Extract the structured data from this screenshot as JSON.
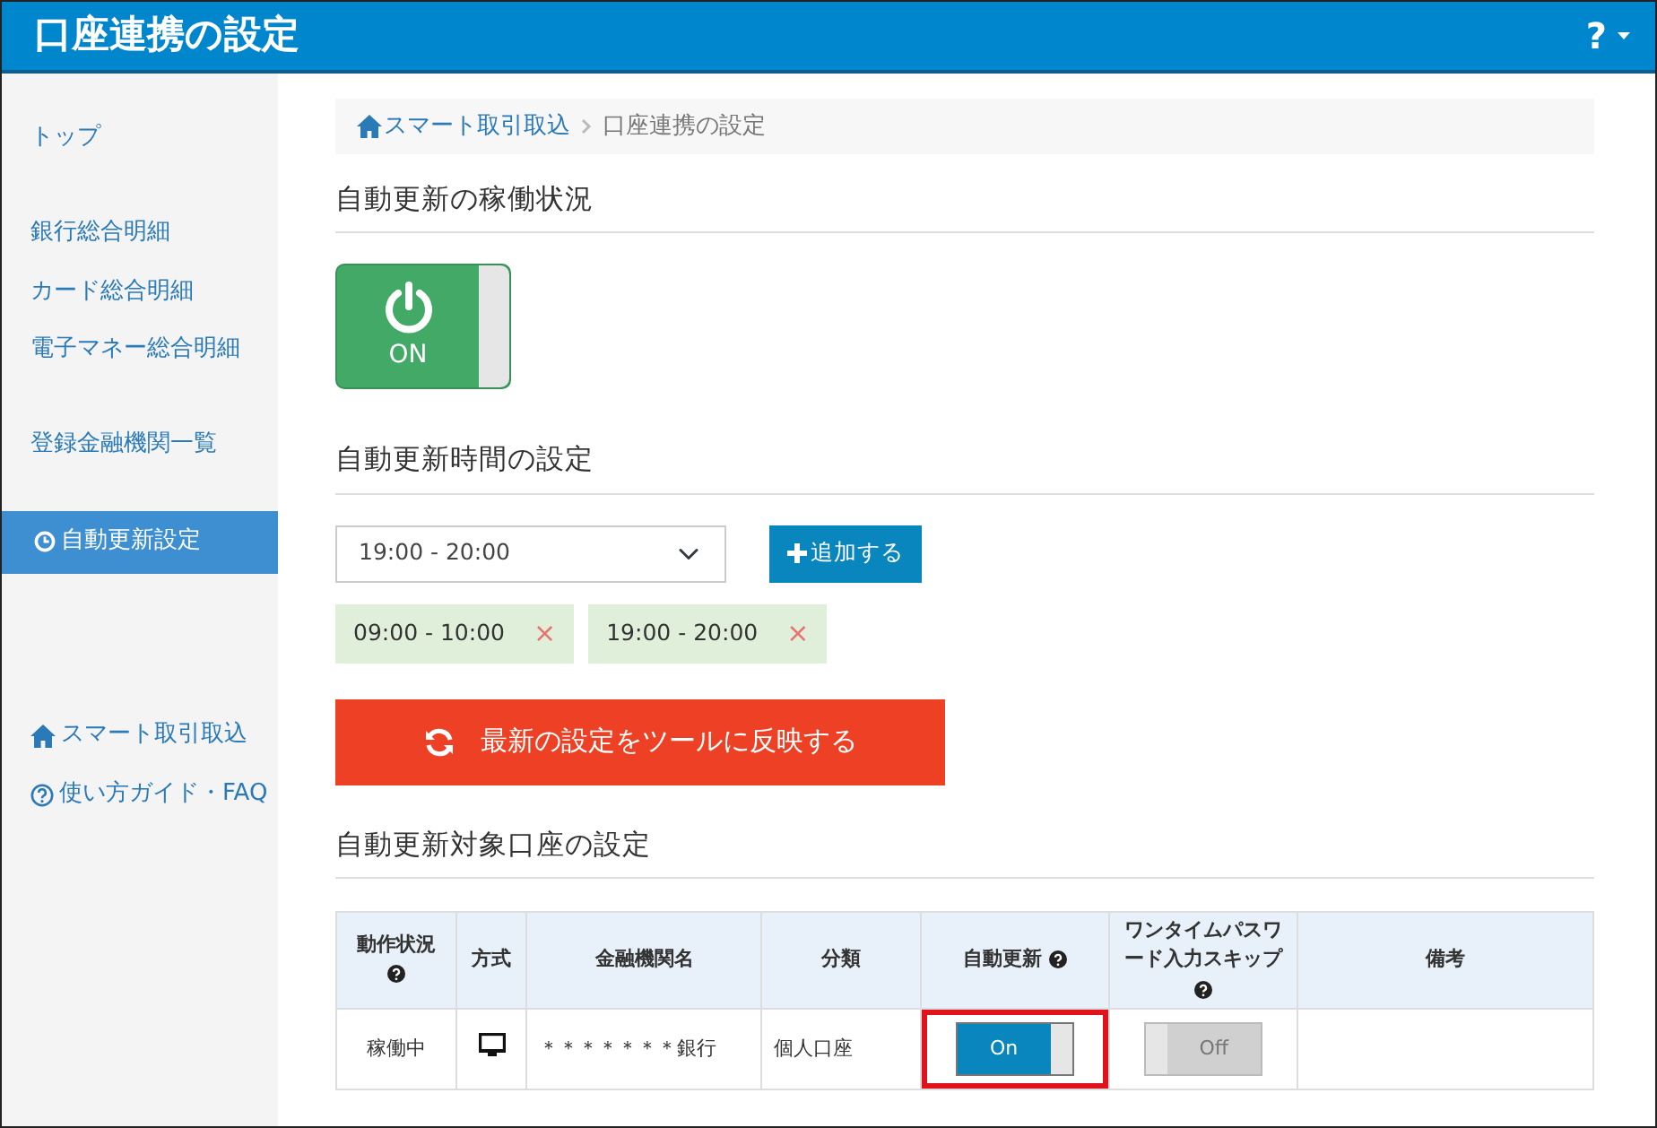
{
  "header": {
    "title": "口座連携の設定",
    "help": "?"
  },
  "sidebar": {
    "groups": [
      {
        "items": [
          {
            "label": "トップ",
            "kind": "plain",
            "selected": false
          }
        ]
      },
      {
        "items": [
          {
            "label": "銀行総合明細",
            "kind": "plain",
            "selected": false
          },
          {
            "label": "カード総合明細",
            "kind": "plain",
            "selected": false
          },
          {
            "label": "電子マネー総合明細",
            "kind": "plain",
            "selected": false
          }
        ]
      },
      {
        "items": [
          {
            "label": "登録金融機関一覧",
            "kind": "plain",
            "selected": false
          }
        ]
      },
      {
        "items": [
          {
            "label": "自動更新設定",
            "kind": "clock",
            "selected": true
          }
        ]
      },
      {
        "items": [
          {
            "label": "スマート取引取込",
            "kind": "home",
            "selected": false
          },
          {
            "label": "使い方ガイド・FAQ",
            "kind": "help",
            "selected": false
          }
        ]
      }
    ]
  },
  "breadcrumb": [
    {
      "label": "スマート取引取込",
      "kind": "home"
    },
    {
      "label": "口座連携の設定",
      "kind": "current"
    }
  ],
  "status_section": {
    "heading": "自動更新の稼働状況",
    "power": {
      "on": true,
      "label": "ON"
    }
  },
  "time_section": {
    "heading": "自動更新時間の設定",
    "select": {
      "value": "19:00 - 20:00"
    },
    "add_button": "追加する",
    "chips": [
      {
        "label": "09:00 - 10:00",
        "remove": "×"
      },
      {
        "label": "19:00 - 20:00",
        "remove": "×"
      }
    ]
  },
  "apply_button": "最新の設定をツールに反映する",
  "accounts_section": {
    "heading": "自動更新対象口座の設定",
    "table": {
      "columns": [
        {
          "label": "動作状況",
          "help": true
        },
        {
          "label": "方式",
          "help": false
        },
        {
          "label": "金融機関名",
          "help": false
        },
        {
          "label": "分類",
          "help": false
        },
        {
          "label": "自動更新",
          "help": true
        },
        {
          "label": "ワンタイムパスワード入力スキップ",
          "help": true
        },
        {
          "label": "備考",
          "help": false
        }
      ],
      "rows": [
        {
          "status": "稼働中",
          "bank": "＊＊＊＊＊＊＊銀行",
          "category": "個人口座",
          "auto_update": {
            "on": true,
            "label": "On",
            "highlighted": true
          },
          "otp_skip": {
            "on": false,
            "label": "Off"
          }
        }
      ]
    }
  }
}
